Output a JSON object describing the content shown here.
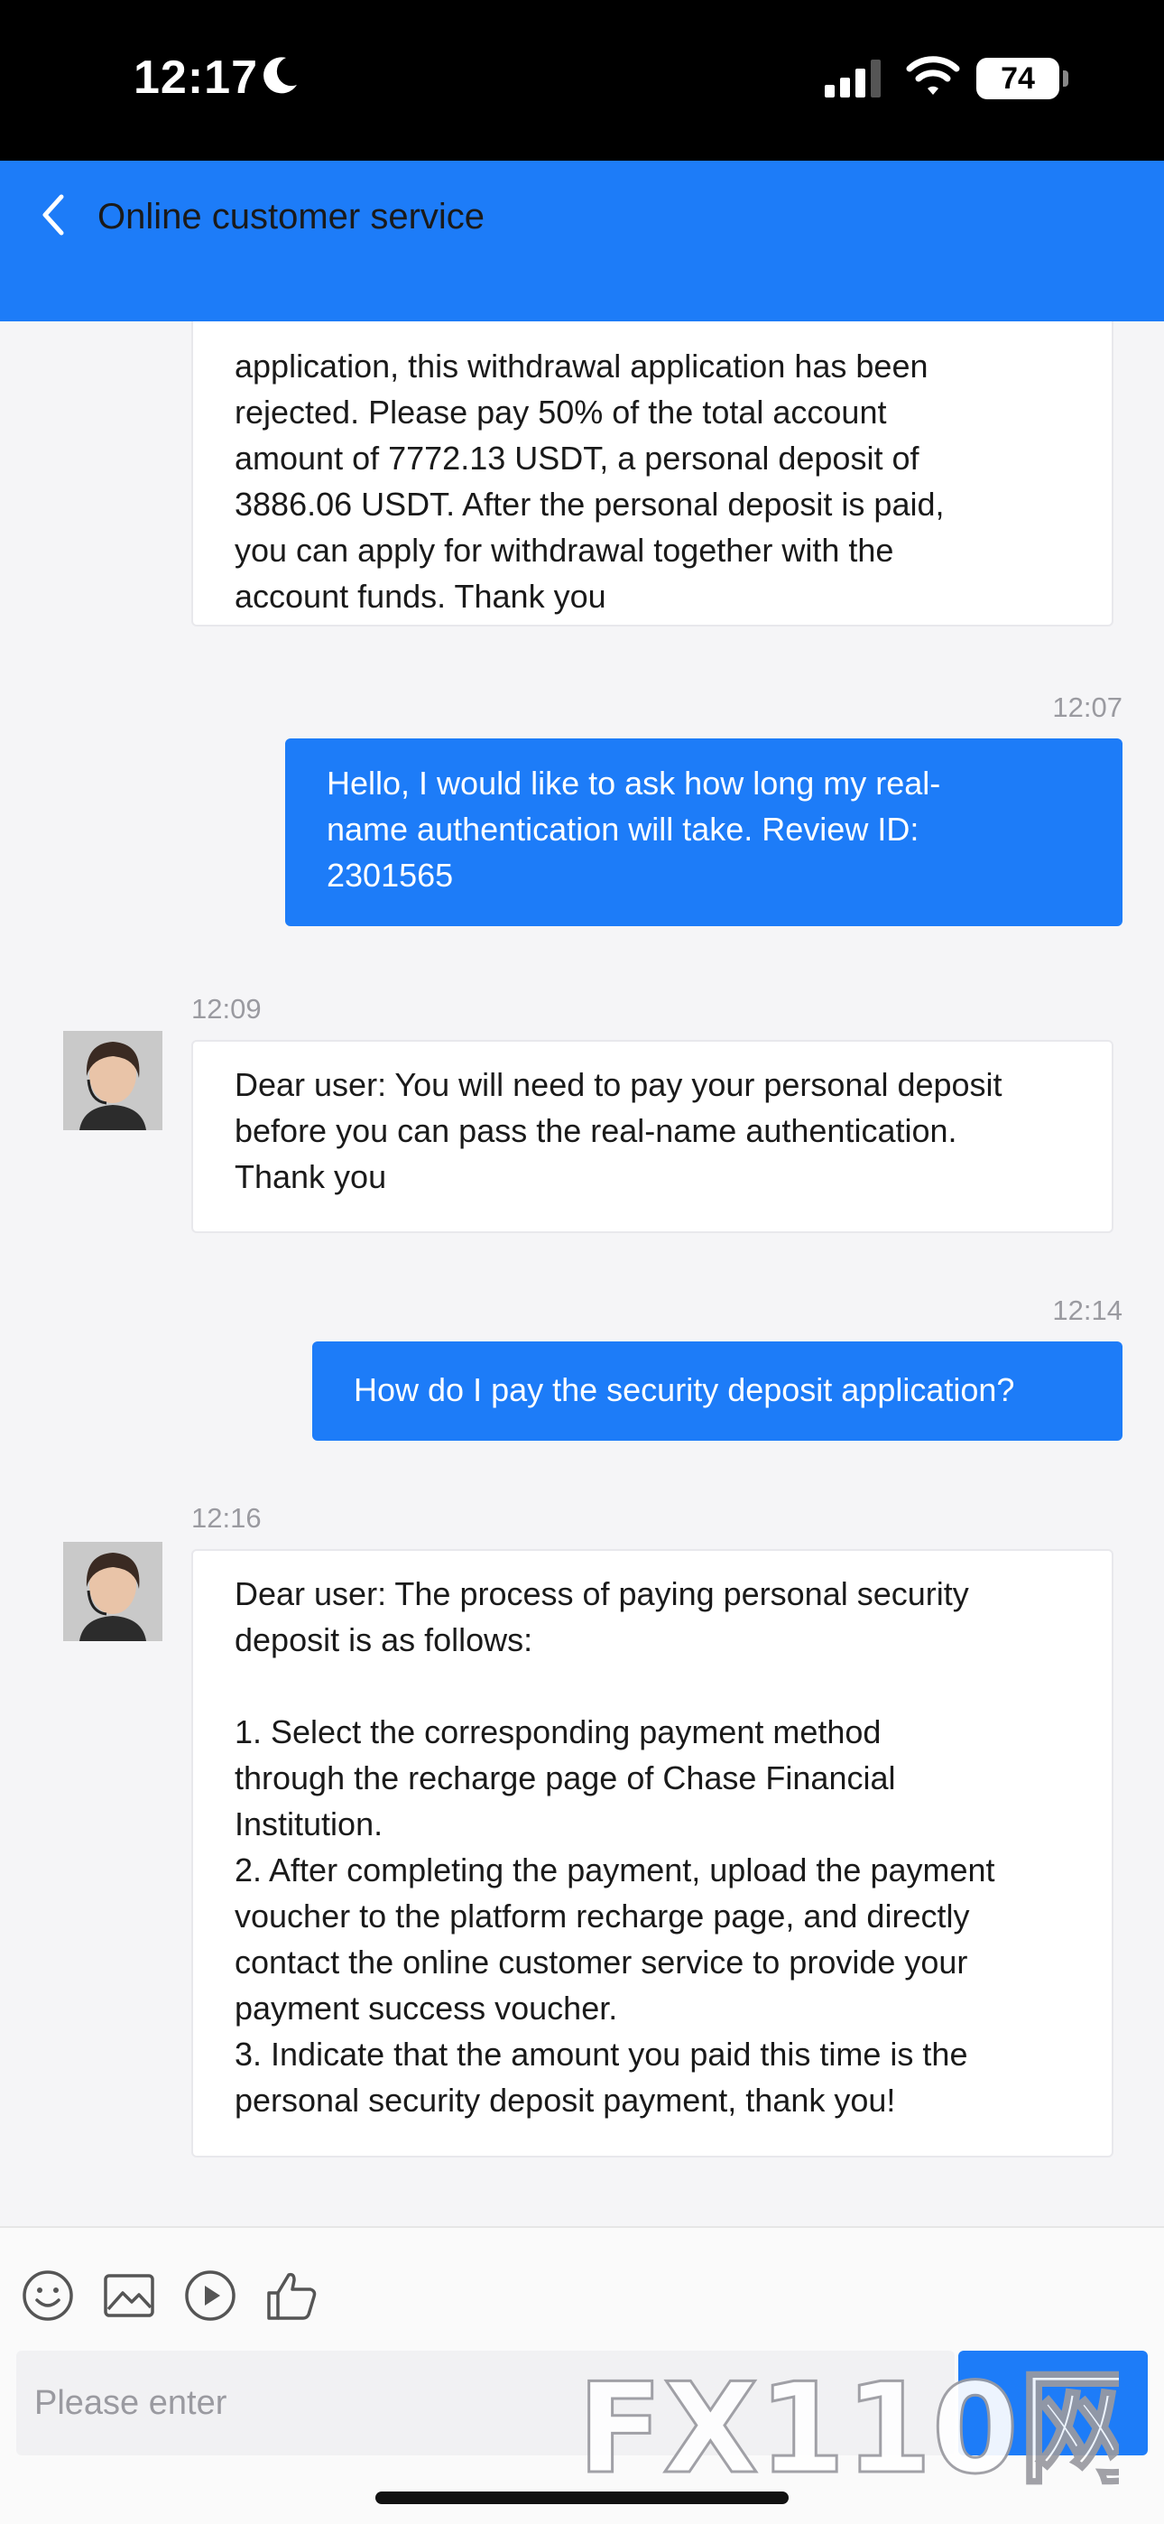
{
  "status_bar": {
    "time": "12:17",
    "battery": "74",
    "icons": [
      "moon-icon",
      "signal-icon",
      "wifi-icon",
      "battery-icon"
    ]
  },
  "header": {
    "title": "Online customer service",
    "back_icon": "chevron-left-icon"
  },
  "messages": [
    {
      "side": "in",
      "lines": [
        "application, this withdrawal application has been",
        "rejected. Please pay 50% of the total account",
        "amount of 7772.13 USDT, a personal deposit of",
        "3886.06 USDT. After the personal deposit is paid,",
        "you can apply for withdrawal together with the",
        "account funds. Thank you"
      ]
    },
    {
      "side": "out",
      "time": "12:07",
      "lines": [
        "Hello, I would like to ask how long my real-",
        "name authentication will take. Review ID:",
        "2301565"
      ]
    },
    {
      "side": "in",
      "time": "12:09",
      "lines": [
        "Dear user: You will need to pay your personal deposit",
        "before you can pass the real-name authentication.",
        "Thank you"
      ]
    },
    {
      "side": "out",
      "time": "12:14",
      "lines": [
        "How do I pay the security deposit application?"
      ]
    },
    {
      "side": "in",
      "time": "12:16",
      "lines": [
        "Dear user: The process of paying personal security",
        "deposit is as follows:",
        "",
        "1. Select the corresponding payment method",
        "through the recharge page of Chase Financial",
        "Institution.",
        "2. After completing the payment, upload the payment",
        "voucher to the platform recharge page, and directly",
        "contact the online customer service to provide your",
        "payment success voucher.",
        "3. Indicate that the amount you paid this time is the",
        "personal security deposit payment, thank you!"
      ]
    }
  ],
  "toolbar": {
    "icons": [
      "emoji-icon",
      "image-icon",
      "video-icon",
      "thumbs-up-icon"
    ]
  },
  "input": {
    "placeholder": "Please enter"
  },
  "watermark": {
    "text": "FX110网"
  },
  "colors": {
    "primary": "#1d7cf8",
    "background": "#f5f5f7",
    "bubble_in": "#ffffff",
    "timestamp": "#9a9aa0"
  }
}
